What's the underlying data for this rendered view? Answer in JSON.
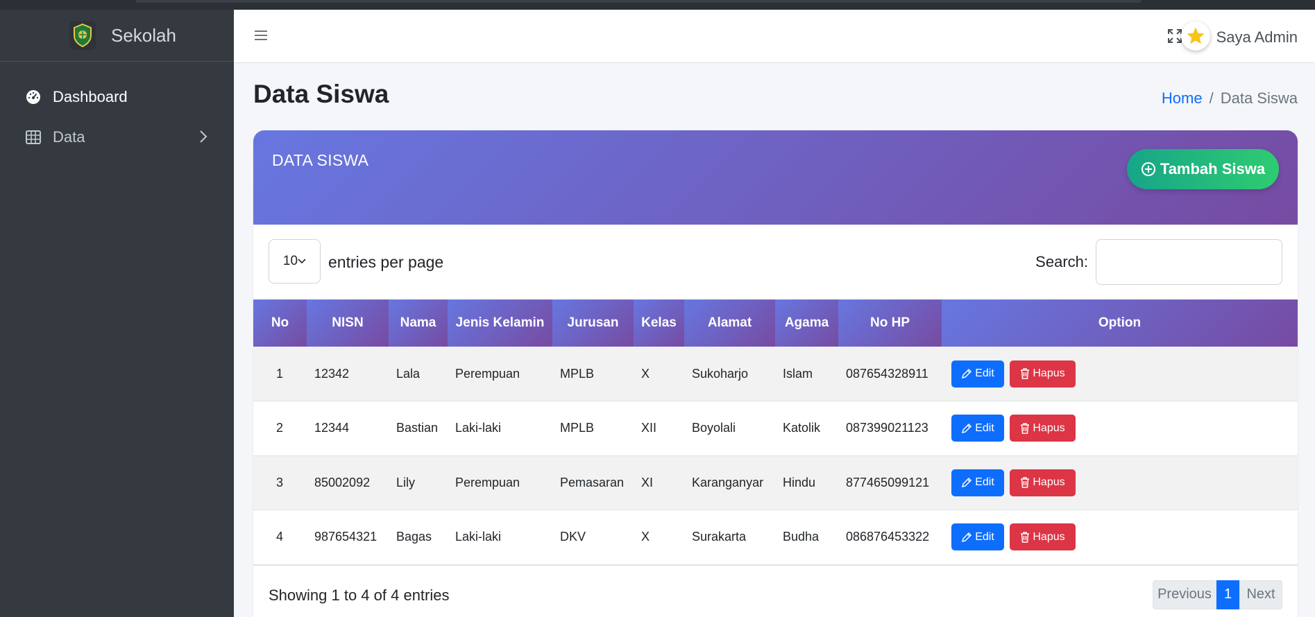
{
  "sidebar": {
    "brand": "Sekolah",
    "items": [
      {
        "label": "Dashboard",
        "icon": "dashboard-gauge-icon"
      },
      {
        "label": "Data",
        "icon": "table-icon"
      }
    ]
  },
  "header": {
    "user_name": "Saya Admin"
  },
  "page": {
    "title": "Data Siswa",
    "breadcrumb": {
      "home": "Home",
      "sep": "/",
      "current": "Data Siswa"
    }
  },
  "card": {
    "title": "DATA SISWA",
    "add_button": "Tambah Siswa"
  },
  "table_controls": {
    "per_page_value": "10",
    "per_page_label": "entries per page",
    "search_label": "Search:"
  },
  "table": {
    "columns": [
      "No",
      "NISN",
      "Nama",
      "Jenis Kelamin",
      "Jurusan",
      "Kelas",
      "Alamat",
      "Agama",
      "No HP",
      "Option"
    ],
    "rows": [
      {
        "no": "1",
        "nisn": "12342",
        "nama": "Lala",
        "jk": "Perempuan",
        "jurusan": "MPLB",
        "kelas": "X",
        "alamat": "Sukoharjo",
        "agama": "Islam",
        "hp": "087654328911"
      },
      {
        "no": "2",
        "nisn": "12344",
        "nama": "Bastian",
        "jk": "Laki-laki",
        "jurusan": "MPLB",
        "kelas": "XII",
        "alamat": "Boyolali",
        "agama": "Katolik",
        "hp": "087399021123"
      },
      {
        "no": "3",
        "nisn": "85002092",
        "nama": "Lily",
        "jk": "Perempuan",
        "jurusan": "Pemasaran",
        "kelas": "XI",
        "alamat": "Karanganyar",
        "agama": "Hindu",
        "hp": "877465099121"
      },
      {
        "no": "4",
        "nisn": "987654321",
        "nama": "Bagas",
        "jk": "Laki-laki",
        "jurusan": "DKV",
        "kelas": "X",
        "alamat": "Surakarta",
        "agama": "Budha",
        "hp": "086876453322"
      }
    ],
    "edit_label": "Edit",
    "delete_label": "Hapus"
  },
  "footer": {
    "info": "Showing 1 to 4 of 4 entries",
    "prev": "Previous",
    "page": "1",
    "next": "Next"
  },
  "colors": {
    "sidebar_bg": "#343a40",
    "gradient_start": "#6777e0",
    "gradient_end": "#764ba2",
    "primary": "#0d6efd",
    "danger": "#dc3545",
    "success": "#2ecc71"
  }
}
